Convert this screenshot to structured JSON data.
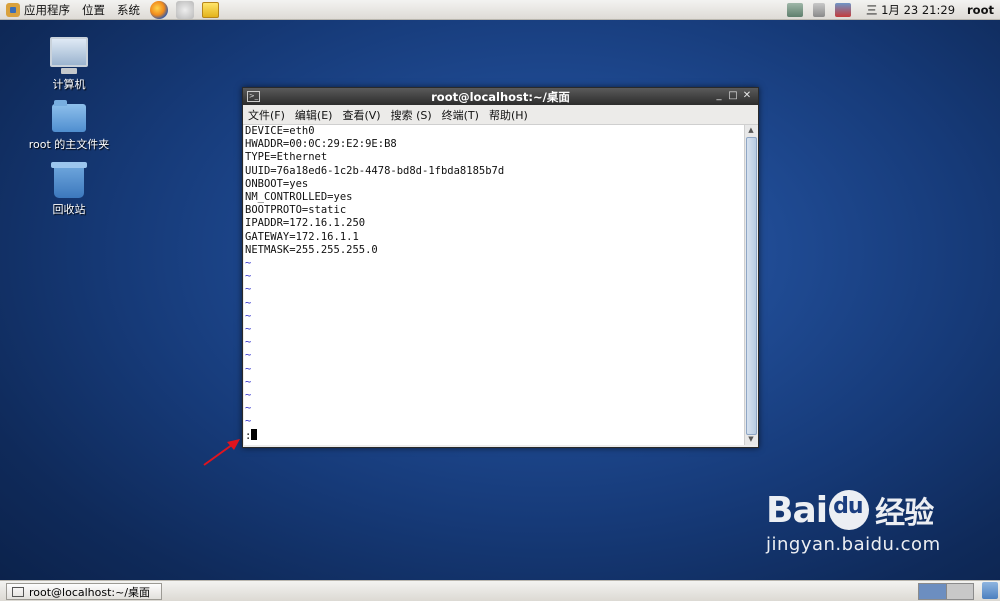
{
  "top_panel": {
    "menus": [
      "应用程序",
      "位置",
      "系统"
    ],
    "clock": "三 1月 23 21:29",
    "user": "root"
  },
  "desktop_icons": [
    {
      "label": "计算机",
      "icon": "computer-icon"
    },
    {
      "label": "root 的主文件夹",
      "icon": "home-folder-icon"
    },
    {
      "label": "回收站",
      "icon": "trash-icon"
    }
  ],
  "terminal": {
    "title": "root@localhost:~/桌面",
    "menu": [
      "文件(F)",
      "编辑(E)",
      "查看(V)",
      "搜索 (S)",
      "终端(T)",
      "帮助(H)"
    ],
    "lines": [
      "DEVICE=eth0",
      "HWADDR=00:0C:29:E2:9E:B8",
      "TYPE=Ethernet",
      "UUID=76a18ed6-1c2b-4478-bd8d-1fbda8185b7d",
      "ONBOOT=yes",
      "NM_CONTROLLED=yes",
      "BOOTPROTO=static",
      "IPADDR=172.16.1.250",
      "GATEWAY=172.16.1.1",
      "NETMASK=255.255.255.0"
    ],
    "tilde_count": 13,
    "prompt": ":"
  },
  "taskbar": {
    "task_label": "root@localhost:~/桌面"
  },
  "watermark": {
    "logo_left": "Bai",
    "logo_cn": "经验",
    "url": "jingyan.baidu.com"
  },
  "colors": {
    "desktop": "#163a78",
    "annotation_arrow": "#e0141e"
  }
}
